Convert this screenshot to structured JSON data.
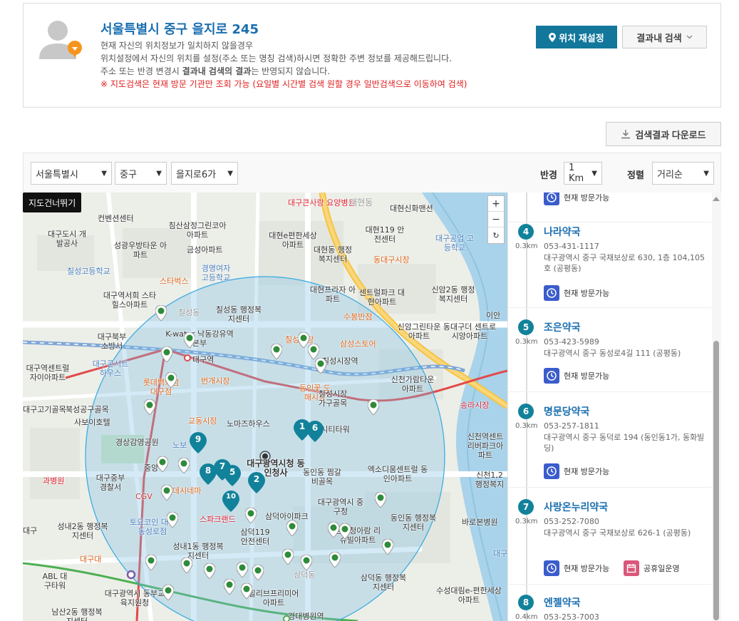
{
  "location": {
    "title": "서울특별시 중구 을지로 245",
    "desc1": "현재 자신의 위치정보가 일치하지 않을경우",
    "desc2": "위치설정에서 자신의 위치를 설정(주소 또는 명칭 검색)하시면 정확한 주변 정보를 제공해드립니다.",
    "desc3_pre": "주소 또는 반경 변경시 ",
    "desc3_bold": "결과내 검색의 결과",
    "desc3_post": "는 반영되지 않습니다.",
    "warning": "※ 지도검색은 현재 방문 기관만 조회 가능 (요일별 시간별 검색 원할 경우 일반검색으로 이동하여 검색)",
    "reset_label": "위치 재설정",
    "within_label": "결과내 검색"
  },
  "download_label": "검색결과 다운로드",
  "filters": {
    "city": "서울특별시",
    "district": "중구",
    "dong": "을지로6가",
    "radius_label": "반경",
    "radius": "1 Km",
    "sort_label": "정렬",
    "sort": "거리순"
  },
  "map": {
    "skip_label": "지도건너뛰기",
    "zoom_in": "+",
    "zoom_out": "−",
    "refresh": "↻",
    "labels": [
      "대구큰사랑 요양병원",
      "대현동",
      "대현신화맨션",
      "컨벤션센터",
      "침산삼정그린코아 아파트",
      "대구도시 개발공사",
      "성광우방타운 아파트",
      "금성아파트",
      "대현e편한세상 아파트",
      "대현동 행정복지센터",
      "대현119 안전센터",
      "동대구시장",
      "대구공업 고등학교",
      "칠성고등학교",
      "스타벅스",
      "경명여자 고등학교",
      "대현프라자 아파트",
      "센트럴파크 대현아파트",
      "신암2동 행정복지센터",
      "대구역서희 스타힐스아파트",
      "칠성동",
      "칠성동 행정복지센터",
      "수봉반점",
      "이안",
      "신암그린타운 아파트",
      "동대구더 센트로시앙아파트",
      "대구북부 소방서",
      "K-water 낙동강유역본부",
      "대구역",
      "칠성시장",
      "삼성스토어",
      "칠성시장역",
      "신천가람타운 아파트",
      "대구역센트럴 자이아파트",
      "대구콘서트 하우스",
      "롯데백화점 대구점",
      "번개시장",
      "동인꽃 도매시장",
      "칠성시장 가구골목",
      "북성공구골목",
      "송라시장",
      "사보이호텔",
      "교동시장",
      "노마즈하우스",
      "동인시티타워",
      "신천역센트 리버파크아파트",
      "경상감영공원",
      "대구광역시청 동인청사",
      "동인동 찜갈비골목",
      "엑소디움센트럴 동인아파트",
      "신천1,2 행정복지",
      "대구중부 경찰서",
      "CGV",
      "데시네마",
      "스파크랜드",
      "삼덕아이파크",
      "대구광역시 중구청",
      "토요코인 대구동성로점",
      "성내2동 행정복지센터",
      "삼덕119 안전센터",
      "동인동 행정복지센터",
      "바로본병원",
      "성내1동 행정복지센터",
      "삼덕청아람 리슈빌아파트",
      "대구",
      "ABL 대구타워",
      "삼덕동 행정복지센터",
      "대구광역시 동부교육지원청",
      "힐리브프리미어 아파트",
      "수성대림e-편한세상 아파트",
      "남산2동 행정복지센터",
      "경대병원역",
      "삼덕동",
      "대구",
      "대구고기골목",
      "과병원",
      "대구대",
      "중앙",
      "노보"
    ]
  },
  "results": [
    {
      "num": "",
      "dist": "",
      "name": "",
      "phone": "",
      "addr": "",
      "badges": [
        "현재 방문가능"
      ]
    },
    {
      "num": "4",
      "dist": "0.3km",
      "name": "나라약국",
      "phone": "053-431-1117",
      "addr": "대구광역시 중구 국채보상로 630, 1층 104,105호 (공평동)",
      "badges": [
        "현재 방문가능"
      ]
    },
    {
      "num": "5",
      "dist": "0.3km",
      "name": "조은약국",
      "phone": "053-423-5989",
      "addr": "대구광역시 중구 동성로4길 111 (공평동)",
      "badges": [
        "현재 방문가능"
      ]
    },
    {
      "num": "6",
      "dist": "0.3km",
      "name": "명문당약국",
      "phone": "053-257-1811",
      "addr": "대구광역시 중구 동덕로 194 (동인동1가, 동화빌딩)",
      "badges": [
        "현재 방문가능"
      ]
    },
    {
      "num": "7",
      "dist": "0.3km",
      "name": "사랑온누리약국",
      "phone": "053-252-7080",
      "addr": "대구광역시 중구 국채보상로 626-1 (공평동)",
      "badges": [
        "현재 방문가능",
        "공휴일운영"
      ]
    },
    {
      "num": "8",
      "dist": "0.4km",
      "name": "엔젤약국",
      "phone": "053-253-7003",
      "addr": "",
      "badges": []
    }
  ],
  "colors": {
    "accent": "#12779b",
    "title": "#1a6fb0",
    "warning": "#e02020",
    "pin_green": "#2e8b3a",
    "pin_teal": "#12829b"
  }
}
